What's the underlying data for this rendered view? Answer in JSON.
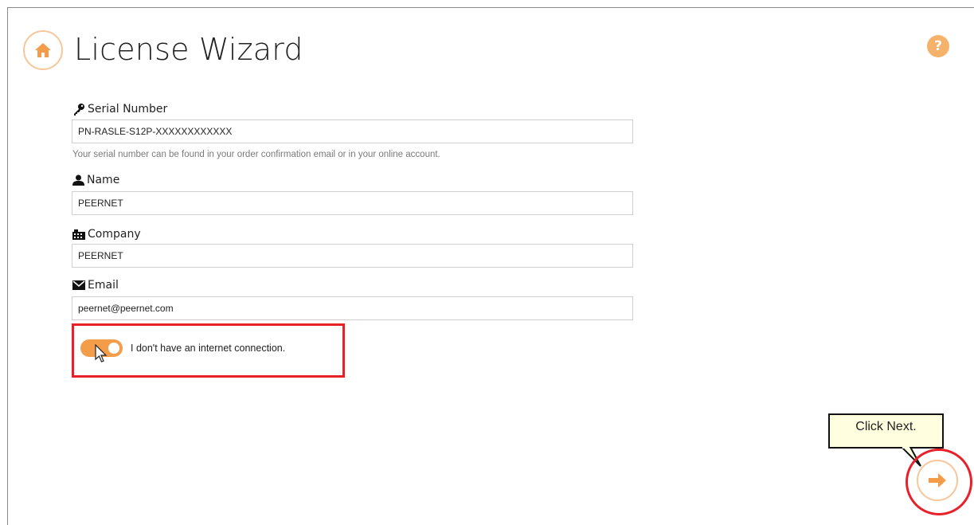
{
  "header": {
    "title": "License Wizard",
    "home_icon": "home-icon",
    "help_icon": "help-icon",
    "help_glyph": "?"
  },
  "form": {
    "serial": {
      "label": "Serial Number",
      "icon": "key-icon",
      "value": "PN-RASLE-S12P-XXXXXXXXXXXX",
      "help": "Your serial number can be found in your order confirmation email or in your online account."
    },
    "name": {
      "label": "Name",
      "icon": "user-icon",
      "value": "PEERNET"
    },
    "company": {
      "label": "Company",
      "icon": "building-icon",
      "value": "PEERNET"
    },
    "email": {
      "label": "Email",
      "icon": "envelope-icon",
      "value": "peernet@peernet.com"
    },
    "offline_toggle": {
      "label": "I don't have an internet connection.",
      "on": true
    }
  },
  "annotation": {
    "callout_text": "Click Next."
  },
  "footer": {
    "next_icon": "arrow-right-icon"
  },
  "colors": {
    "accent": "#f39c4a",
    "accent_light": "#f6c79a",
    "highlight": "#e8202a",
    "callout_bg": "#ffffe0"
  }
}
